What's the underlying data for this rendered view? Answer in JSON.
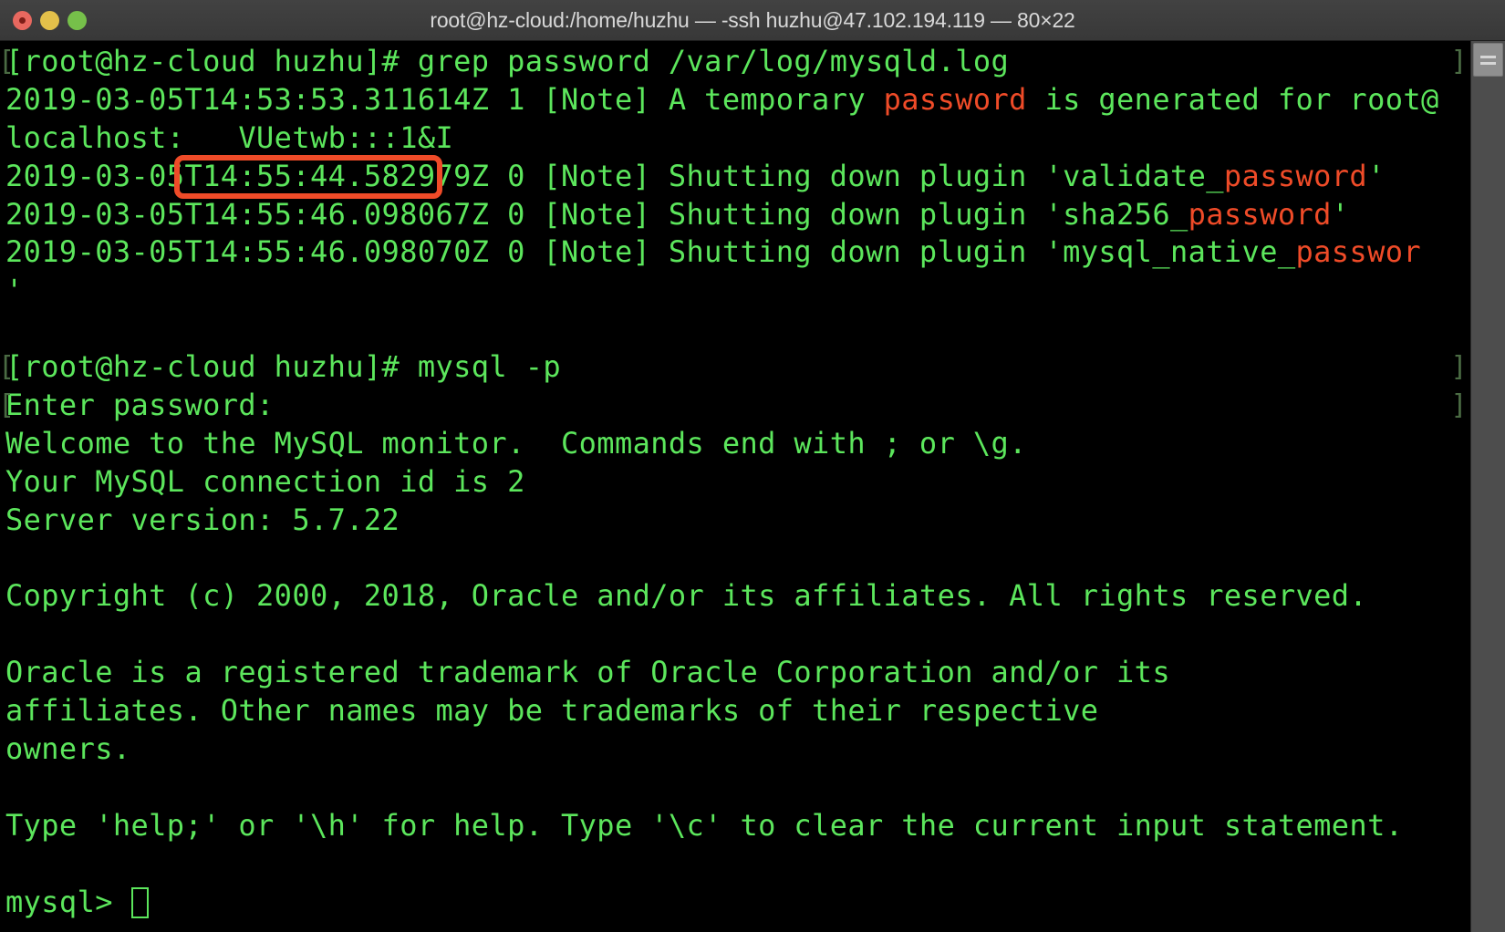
{
  "window": {
    "title": "root@hz-cloud:/home/huzhu — -ssh huzhu@47.102.194.119 — 80×22",
    "traffic_lights": {
      "close_label": "close",
      "minimize_label": "minimize",
      "zoom_label": "zoom"
    }
  },
  "colors": {
    "background": "#000000",
    "foreground_green": "#5ce65c",
    "match_red": "#ef4b28",
    "titlebar": "#3c3c3c",
    "title_text": "#d8d8d8",
    "annotation_border": "#ef4b28",
    "prompt_mark": "#4a6b43",
    "scrollbar_track": "#4d4d4d",
    "scrollbar_thumb": "#8f8f8f",
    "light_close": "#e8685f",
    "light_minimize": "#e3c04a",
    "light_zoom": "#76c04a"
  },
  "annotation": {
    "highlighted_text": "VUetwb:::1&I",
    "purpose": "temporary-mysql-root-password"
  },
  "prompt_mark_glyphs": {
    "left": "[",
    "right": "]"
  },
  "terminal": {
    "cursor": "block-outline",
    "rows": [
      {
        "id": "row-grep-command",
        "mark_left": true,
        "mark_right": true,
        "segments": [
          {
            "text": "[root@hz-cloud huzhu]# grep password /var/log/mysqld.log",
            "color": "green"
          }
        ]
      },
      {
        "id": "row-temp-password-1",
        "mark_left": false,
        "mark_right": false,
        "segments": [
          {
            "text": "2019-03-05T14:53:53.311614Z 1 [Note] A temporary ",
            "color": "green"
          },
          {
            "text": "password",
            "color": "red"
          },
          {
            "text": " is generated for root@",
            "color": "green"
          }
        ]
      },
      {
        "id": "row-temp-password-2",
        "mark_left": false,
        "mark_right": false,
        "segments": [
          {
            "text": "localhost:   VUetwb:::1&I",
            "color": "green"
          }
        ]
      },
      {
        "id": "row-shutdown-validate-password",
        "mark_left": false,
        "mark_right": false,
        "segments": [
          {
            "text": "2019-03-05T14:55:44.582979Z 0 [Note] Shutting down plugin 'validate_",
            "color": "green"
          },
          {
            "text": "password",
            "color": "red"
          },
          {
            "text": "'",
            "color": "green"
          }
        ]
      },
      {
        "id": "row-shutdown-sha256-password",
        "mark_left": false,
        "mark_right": false,
        "segments": [
          {
            "text": "2019-03-05T14:55:46.098067Z 0 [Note] Shutting down plugin 'sha256_",
            "color": "green"
          },
          {
            "text": "password",
            "color": "red"
          },
          {
            "text": "'",
            "color": "green"
          }
        ]
      },
      {
        "id": "row-shutdown-mysql-native-password",
        "mark_left": false,
        "mark_right": false,
        "segments": [
          {
            "text": "2019-03-05T14:55:46.098070Z 0 [Note] Shutting down plugin 'mysql_native_",
            "color": "green"
          },
          {
            "text": "passwor",
            "color": "red"
          },
          {
            "text": "",
            "color": "green"
          }
        ]
      },
      {
        "id": "row-shutdown-wrap",
        "mark_left": false,
        "mark_right": false,
        "segments": [
          {
            "text": "'",
            "color": "green"
          }
        ]
      },
      {
        "id": "row-blank-1",
        "mark_left": false,
        "mark_right": false,
        "segments": [
          {
            "text": "",
            "color": "green"
          }
        ]
      },
      {
        "id": "row-mysql-command",
        "mark_left": true,
        "mark_right": true,
        "segments": [
          {
            "text": "[root@hz-cloud huzhu]# mysql -p",
            "color": "green"
          }
        ]
      },
      {
        "id": "row-enter-password",
        "mark_left": true,
        "mark_right": true,
        "segments": [
          {
            "text": "Enter password: ",
            "color": "green"
          }
        ]
      },
      {
        "id": "row-welcome",
        "mark_left": false,
        "mark_right": false,
        "segments": [
          {
            "text": "Welcome to the MySQL monitor.  Commands end with ; or \\g.",
            "color": "green"
          }
        ]
      },
      {
        "id": "row-connection-id",
        "mark_left": false,
        "mark_right": false,
        "segments": [
          {
            "text": "Your MySQL connection id is 2",
            "color": "green"
          }
        ]
      },
      {
        "id": "row-server-version",
        "mark_left": false,
        "mark_right": false,
        "segments": [
          {
            "text": "Server version: 5.7.22",
            "color": "green"
          }
        ]
      },
      {
        "id": "row-blank-2",
        "mark_left": false,
        "mark_right": false,
        "segments": [
          {
            "text": "",
            "color": "green"
          }
        ]
      },
      {
        "id": "row-copyright",
        "mark_left": false,
        "mark_right": false,
        "segments": [
          {
            "text": "Copyright (c) 2000, 2018, Oracle and/or its affiliates. All rights reserved.",
            "color": "green"
          }
        ]
      },
      {
        "id": "row-blank-3",
        "mark_left": false,
        "mark_right": false,
        "segments": [
          {
            "text": "",
            "color": "green"
          }
        ]
      },
      {
        "id": "row-trademark-1",
        "mark_left": false,
        "mark_right": false,
        "segments": [
          {
            "text": "Oracle is a registered trademark of Oracle Corporation and/or its",
            "color": "green"
          }
        ]
      },
      {
        "id": "row-trademark-2",
        "mark_left": false,
        "mark_right": false,
        "segments": [
          {
            "text": "affiliates. Other names may be trademarks of their respective",
            "color": "green"
          }
        ]
      },
      {
        "id": "row-trademark-3",
        "mark_left": false,
        "mark_right": false,
        "segments": [
          {
            "text": "owners.",
            "color": "green"
          }
        ]
      },
      {
        "id": "row-blank-4",
        "mark_left": false,
        "mark_right": false,
        "segments": [
          {
            "text": "",
            "color": "green"
          }
        ]
      },
      {
        "id": "row-help-hint",
        "mark_left": false,
        "mark_right": false,
        "segments": [
          {
            "text": "Type 'help;' or '\\h' for help. Type '\\c' to clear the current input statement.",
            "color": "green"
          }
        ]
      },
      {
        "id": "row-blank-5",
        "mark_left": false,
        "mark_right": false,
        "segments": [
          {
            "text": "",
            "color": "green"
          }
        ]
      },
      {
        "id": "row-mysql-prompt",
        "mark_left": false,
        "mark_right": false,
        "cursor": true,
        "segments": [
          {
            "text": "mysql> ",
            "color": "green"
          }
        ]
      }
    ]
  }
}
